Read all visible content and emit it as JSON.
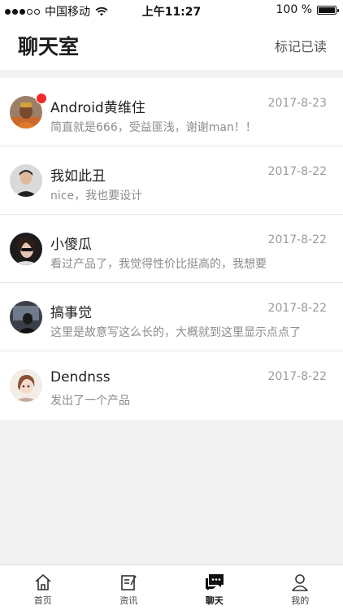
{
  "status_bar": {
    "carrier": "中国移动",
    "time": "上午11:27",
    "battery": "100 %"
  },
  "header": {
    "title": "聊天室",
    "action": "标记已读"
  },
  "chats": [
    {
      "name": "Android黄维住",
      "date": "2017-8-23",
      "preview": "简直就是666，受益匪浅，谢谢man！！",
      "unread": true
    },
    {
      "name": "我如此丑",
      "date": "2017-8-22",
      "preview": "nice，我也要设计",
      "unread": false
    },
    {
      "name": "小傻瓜",
      "date": "2017-8-22",
      "preview": "看过产品了，我觉得性价比挺高的，我想要",
      "unread": false
    },
    {
      "name": "搞事觉",
      "date": "2017-8-22",
      "preview": "这里是故意写这么长的，大概就到这里显示点点了",
      "unread": false
    },
    {
      "name": "Dendnss",
      "date": "2017-8-22",
      "preview": "发出了一个产品",
      "unread": false
    }
  ],
  "tabs": [
    {
      "label": "首页",
      "icon": "home-icon",
      "active": false
    },
    {
      "label": "资讯",
      "icon": "news-icon",
      "active": false
    },
    {
      "label": "聊天",
      "icon": "chat-icon",
      "active": true
    },
    {
      "label": "我的",
      "icon": "user-icon",
      "active": false
    }
  ],
  "colors": {
    "unread_badge": "#f02b2b",
    "background": "#f3f3f3"
  }
}
